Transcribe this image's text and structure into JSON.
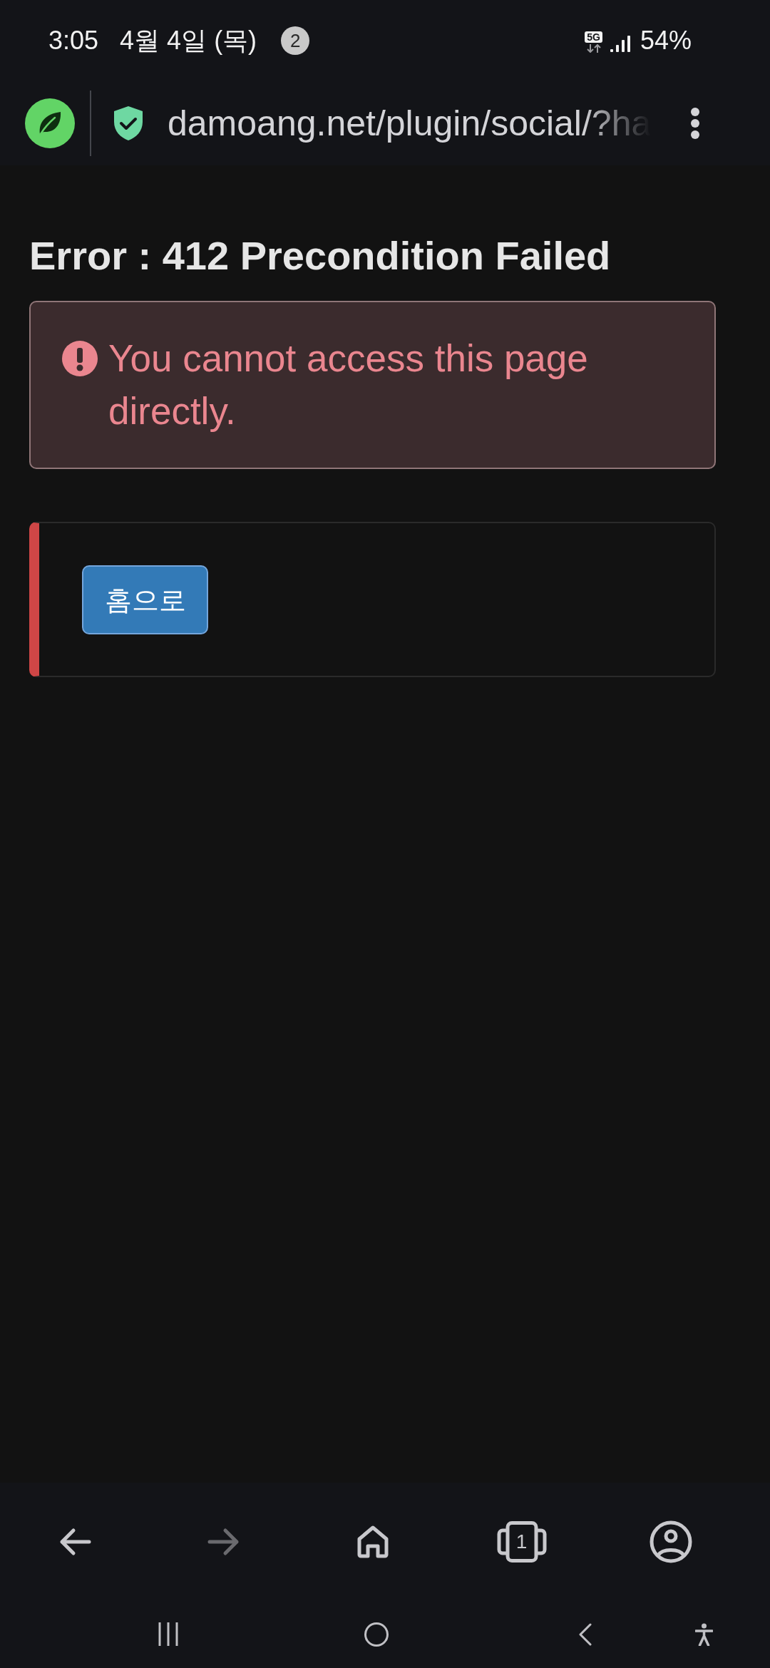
{
  "status_bar": {
    "time": "3:05",
    "date": "4월 4일 (목)",
    "notification_count": "2",
    "network": "5G",
    "battery": "54%"
  },
  "browser_bar": {
    "url": "damoang.net/plugin/social/?ha"
  },
  "page": {
    "title": "Error : 412 Precondition Failed",
    "alert": {
      "message": "You cannot access this page directly."
    },
    "home_button": "홈으로"
  },
  "bottom_nav": {
    "items": [
      {
        "kind": "back",
        "disabled": false
      },
      {
        "kind": "forward",
        "disabled": true
      },
      {
        "kind": "home",
        "disabled": false
      },
      {
        "kind": "tabs",
        "disabled": false,
        "count": "1"
      },
      {
        "kind": "profile",
        "disabled": false
      }
    ]
  }
}
